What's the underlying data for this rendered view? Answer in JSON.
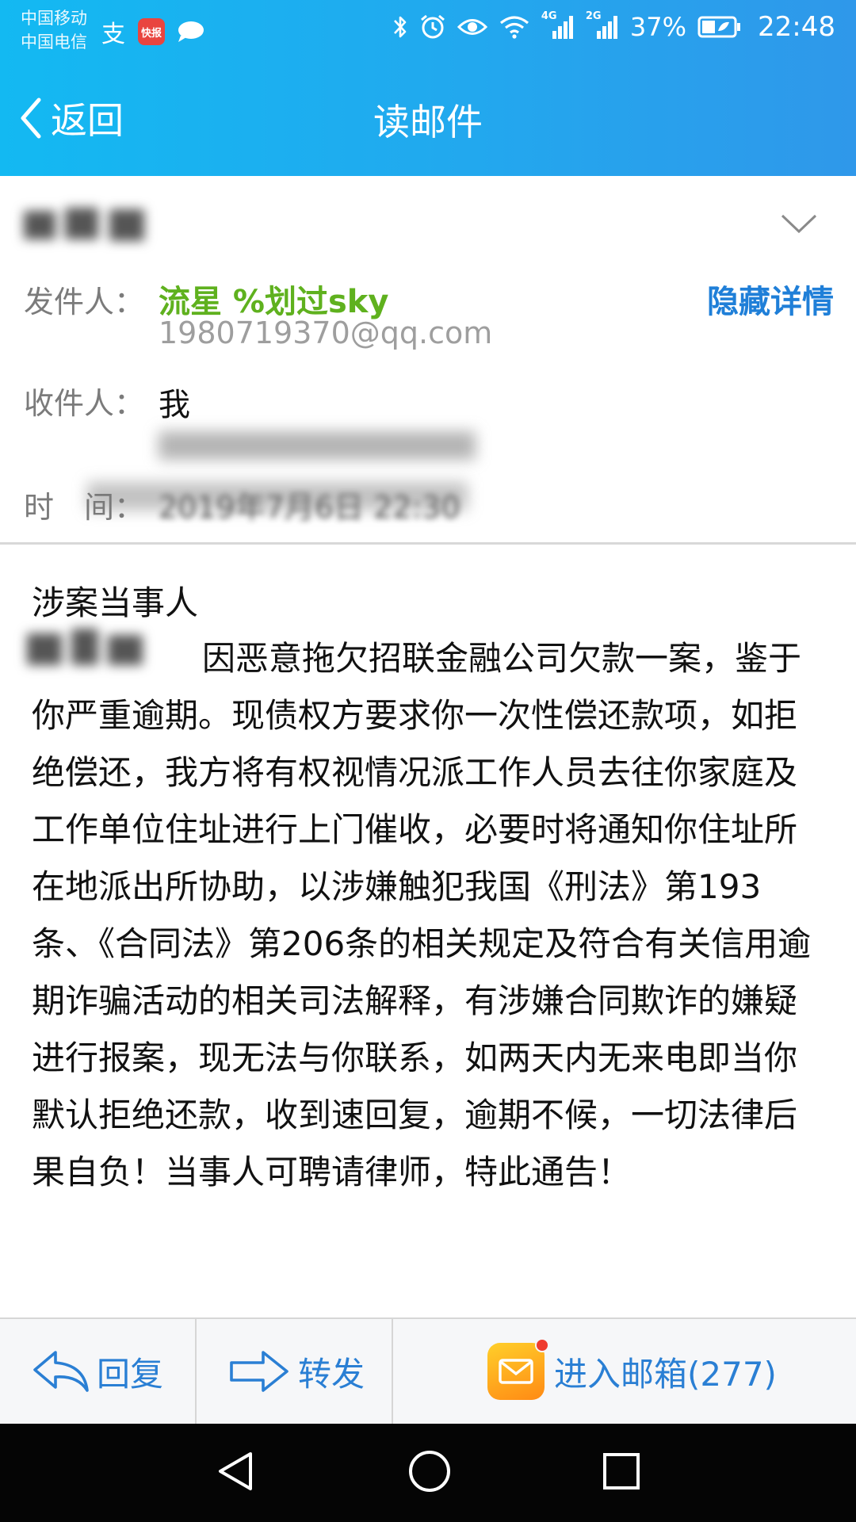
{
  "status_bar": {
    "carrier_1": "中国移动",
    "carrier_2": "中国电信",
    "app_icons": [
      "alipay-icon",
      "kuaibao-icon",
      "chat-bubble-icon"
    ],
    "kuaibao_text": "快报",
    "signal_1_tag": "4G",
    "signal_2_tag": "2G",
    "battery": "37%",
    "time": "22:48",
    "system_icons": [
      "bluetooth-icon",
      "alarm-icon",
      "eye-comfort-icon",
      "wifi-icon",
      "signal-icon",
      "battery-icon"
    ]
  },
  "title_bar": {
    "back_label": "返回",
    "title": "读邮件"
  },
  "mail": {
    "sender_label": "发件人：",
    "sender_name": "流星 %划过sky",
    "sender_email": "1980719370@qq.com",
    "hide_details": "隐藏详情",
    "recipient_label": "收件人：",
    "recipient": "我",
    "time_label": "时　间：",
    "date": "2019年7月6日 22:30",
    "greeting": "涉案当事人",
    "body": "因恶意拖欠招联金融公司欠款一案，鉴于你严重逾期。现债权方要求你一次性偿还款项，如拒绝偿还，我方将有权视情况派工作人员去往你家庭及工作单位住址进行上门催收，必要时将通知你住址所在地派出所协助，以涉嫌触犯我国《刑法》第193条、《合同法》第206条的相关规定及符合有关信用逾期诈骗活动的相关司法解释，有涉嫌合同欺诈的嫌疑进行报案，现无法与你联系，如两天内无来电即当你默认拒绝还款，收到速回复，逾期不候，一切法律后果自负！当事人可聘请律师，特此通告！"
  },
  "actions": {
    "reply": "回复",
    "forward": "转发",
    "inbox": "进入邮箱(277)"
  },
  "colors": {
    "header_start": "#13b9f2",
    "header_end": "#2f98ea",
    "sender_green": "#5fb11e",
    "link_blue": "#1f7fd8",
    "action_blue": "#2a7fd4"
  }
}
